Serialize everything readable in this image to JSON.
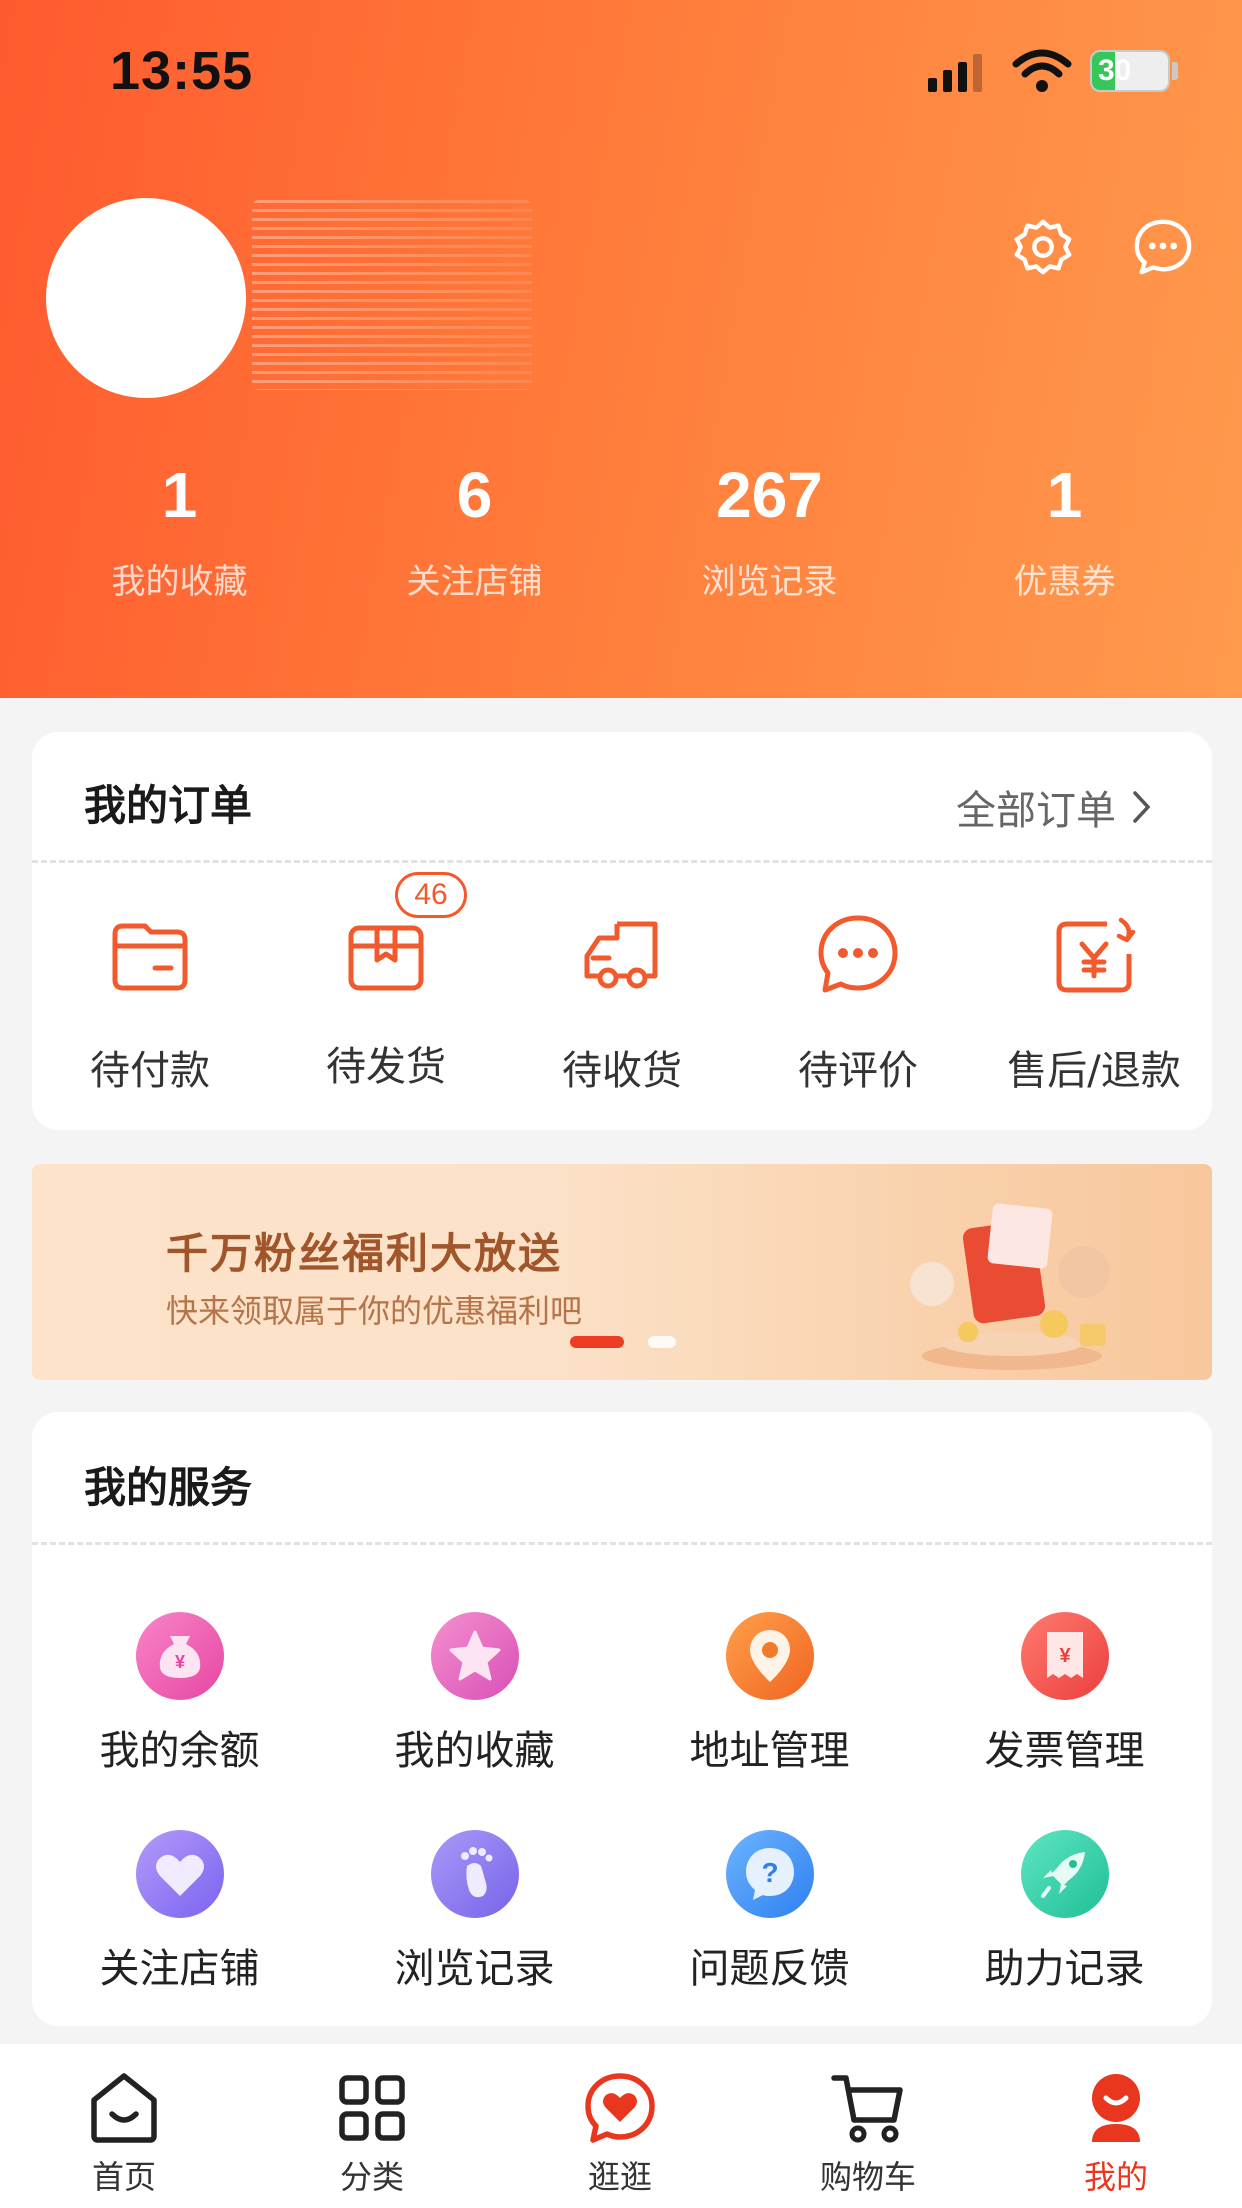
{
  "status_bar": {
    "time": "13:55",
    "battery": "30",
    "battery_level": 0.3
  },
  "profile": {
    "stats": [
      {
        "value": "1",
        "label": "我的收藏"
      },
      {
        "value": "6",
        "label": "关注店铺"
      },
      {
        "value": "267",
        "label": "浏览记录"
      },
      {
        "value": "1",
        "label": "优惠券"
      }
    ]
  },
  "orders": {
    "title": "我的订单",
    "all_link": "全部订单",
    "items": [
      {
        "label": "待付款",
        "icon": "wallet-icon"
      },
      {
        "label": "待发货",
        "icon": "package-icon",
        "badge": "46"
      },
      {
        "label": "待收货",
        "icon": "truck-icon"
      },
      {
        "label": "待评价",
        "icon": "chat-bubble-icon"
      },
      {
        "label": "售后/退款",
        "icon": "refund-icon"
      }
    ]
  },
  "banner": {
    "title": "千万粉丝福利大放送",
    "subtitle": "快来领取属于你的优惠福利吧"
  },
  "services": {
    "title": "我的服务",
    "items": [
      {
        "label": "我的余额",
        "icon": "money-bag-icon"
      },
      {
        "label": "我的收藏",
        "icon": "star-icon"
      },
      {
        "label": "地址管理",
        "icon": "location-pin-icon"
      },
      {
        "label": "发票管理",
        "icon": "invoice-icon"
      },
      {
        "label": "关注店铺",
        "icon": "heart-icon"
      },
      {
        "label": "浏览记录",
        "icon": "footprint-icon"
      },
      {
        "label": "问题反馈",
        "icon": "question-icon"
      },
      {
        "label": "助力记录",
        "icon": "rocket-icon"
      }
    ]
  },
  "tabbar": {
    "items": [
      {
        "label": "首页",
        "icon": "home-icon"
      },
      {
        "label": "分类",
        "icon": "category-grid-icon"
      },
      {
        "label": "逛逛",
        "icon": "heart-bubble-icon"
      },
      {
        "label": "购物车",
        "icon": "cart-icon"
      },
      {
        "label": "我的",
        "icon": "profile-icon",
        "active": true
      }
    ]
  },
  "colors": {
    "accent": "#F25A2E",
    "active_tab": "#E8361F",
    "header_start": "#FF5A2E",
    "header_end": "#FF9A4D"
  }
}
